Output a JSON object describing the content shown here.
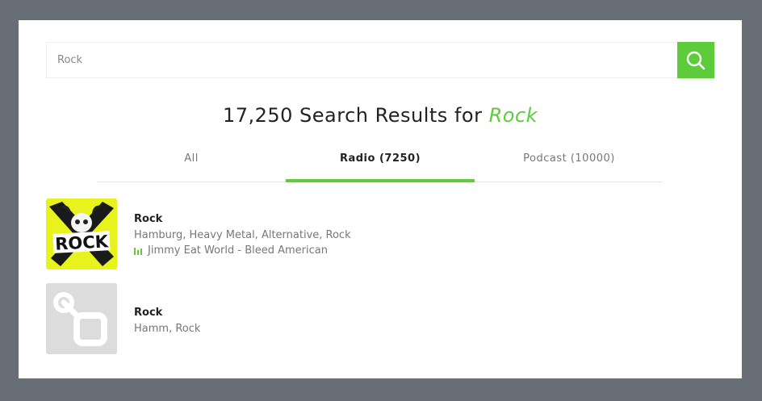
{
  "search": {
    "value": "Rock",
    "placeholder": "Rock",
    "button_icon": "search-icon"
  },
  "heading": {
    "prefix": "17,250 Search Results for",
    "query": "Rock"
  },
  "tabs": [
    {
      "label": "All",
      "active": false
    },
    {
      "label": "Radio (7250)",
      "active": true
    },
    {
      "label": "Podcast (10000)",
      "active": false
    }
  ],
  "results": [
    {
      "title": "Rock",
      "subtitle": "Hamburg, Heavy Metal, Alternative, Rock",
      "now_playing": "Jimmy Eat World - Bleed American",
      "thumb_text": "ROCK",
      "thumb_icon": "rock-station-logo"
    },
    {
      "title": "Rock",
      "subtitle": "Hamm, Rock",
      "thumb_icon": "placeholder-station-logo"
    }
  ],
  "colors": {
    "accent": "#5dcb3a",
    "page_bg": "#676e75"
  }
}
